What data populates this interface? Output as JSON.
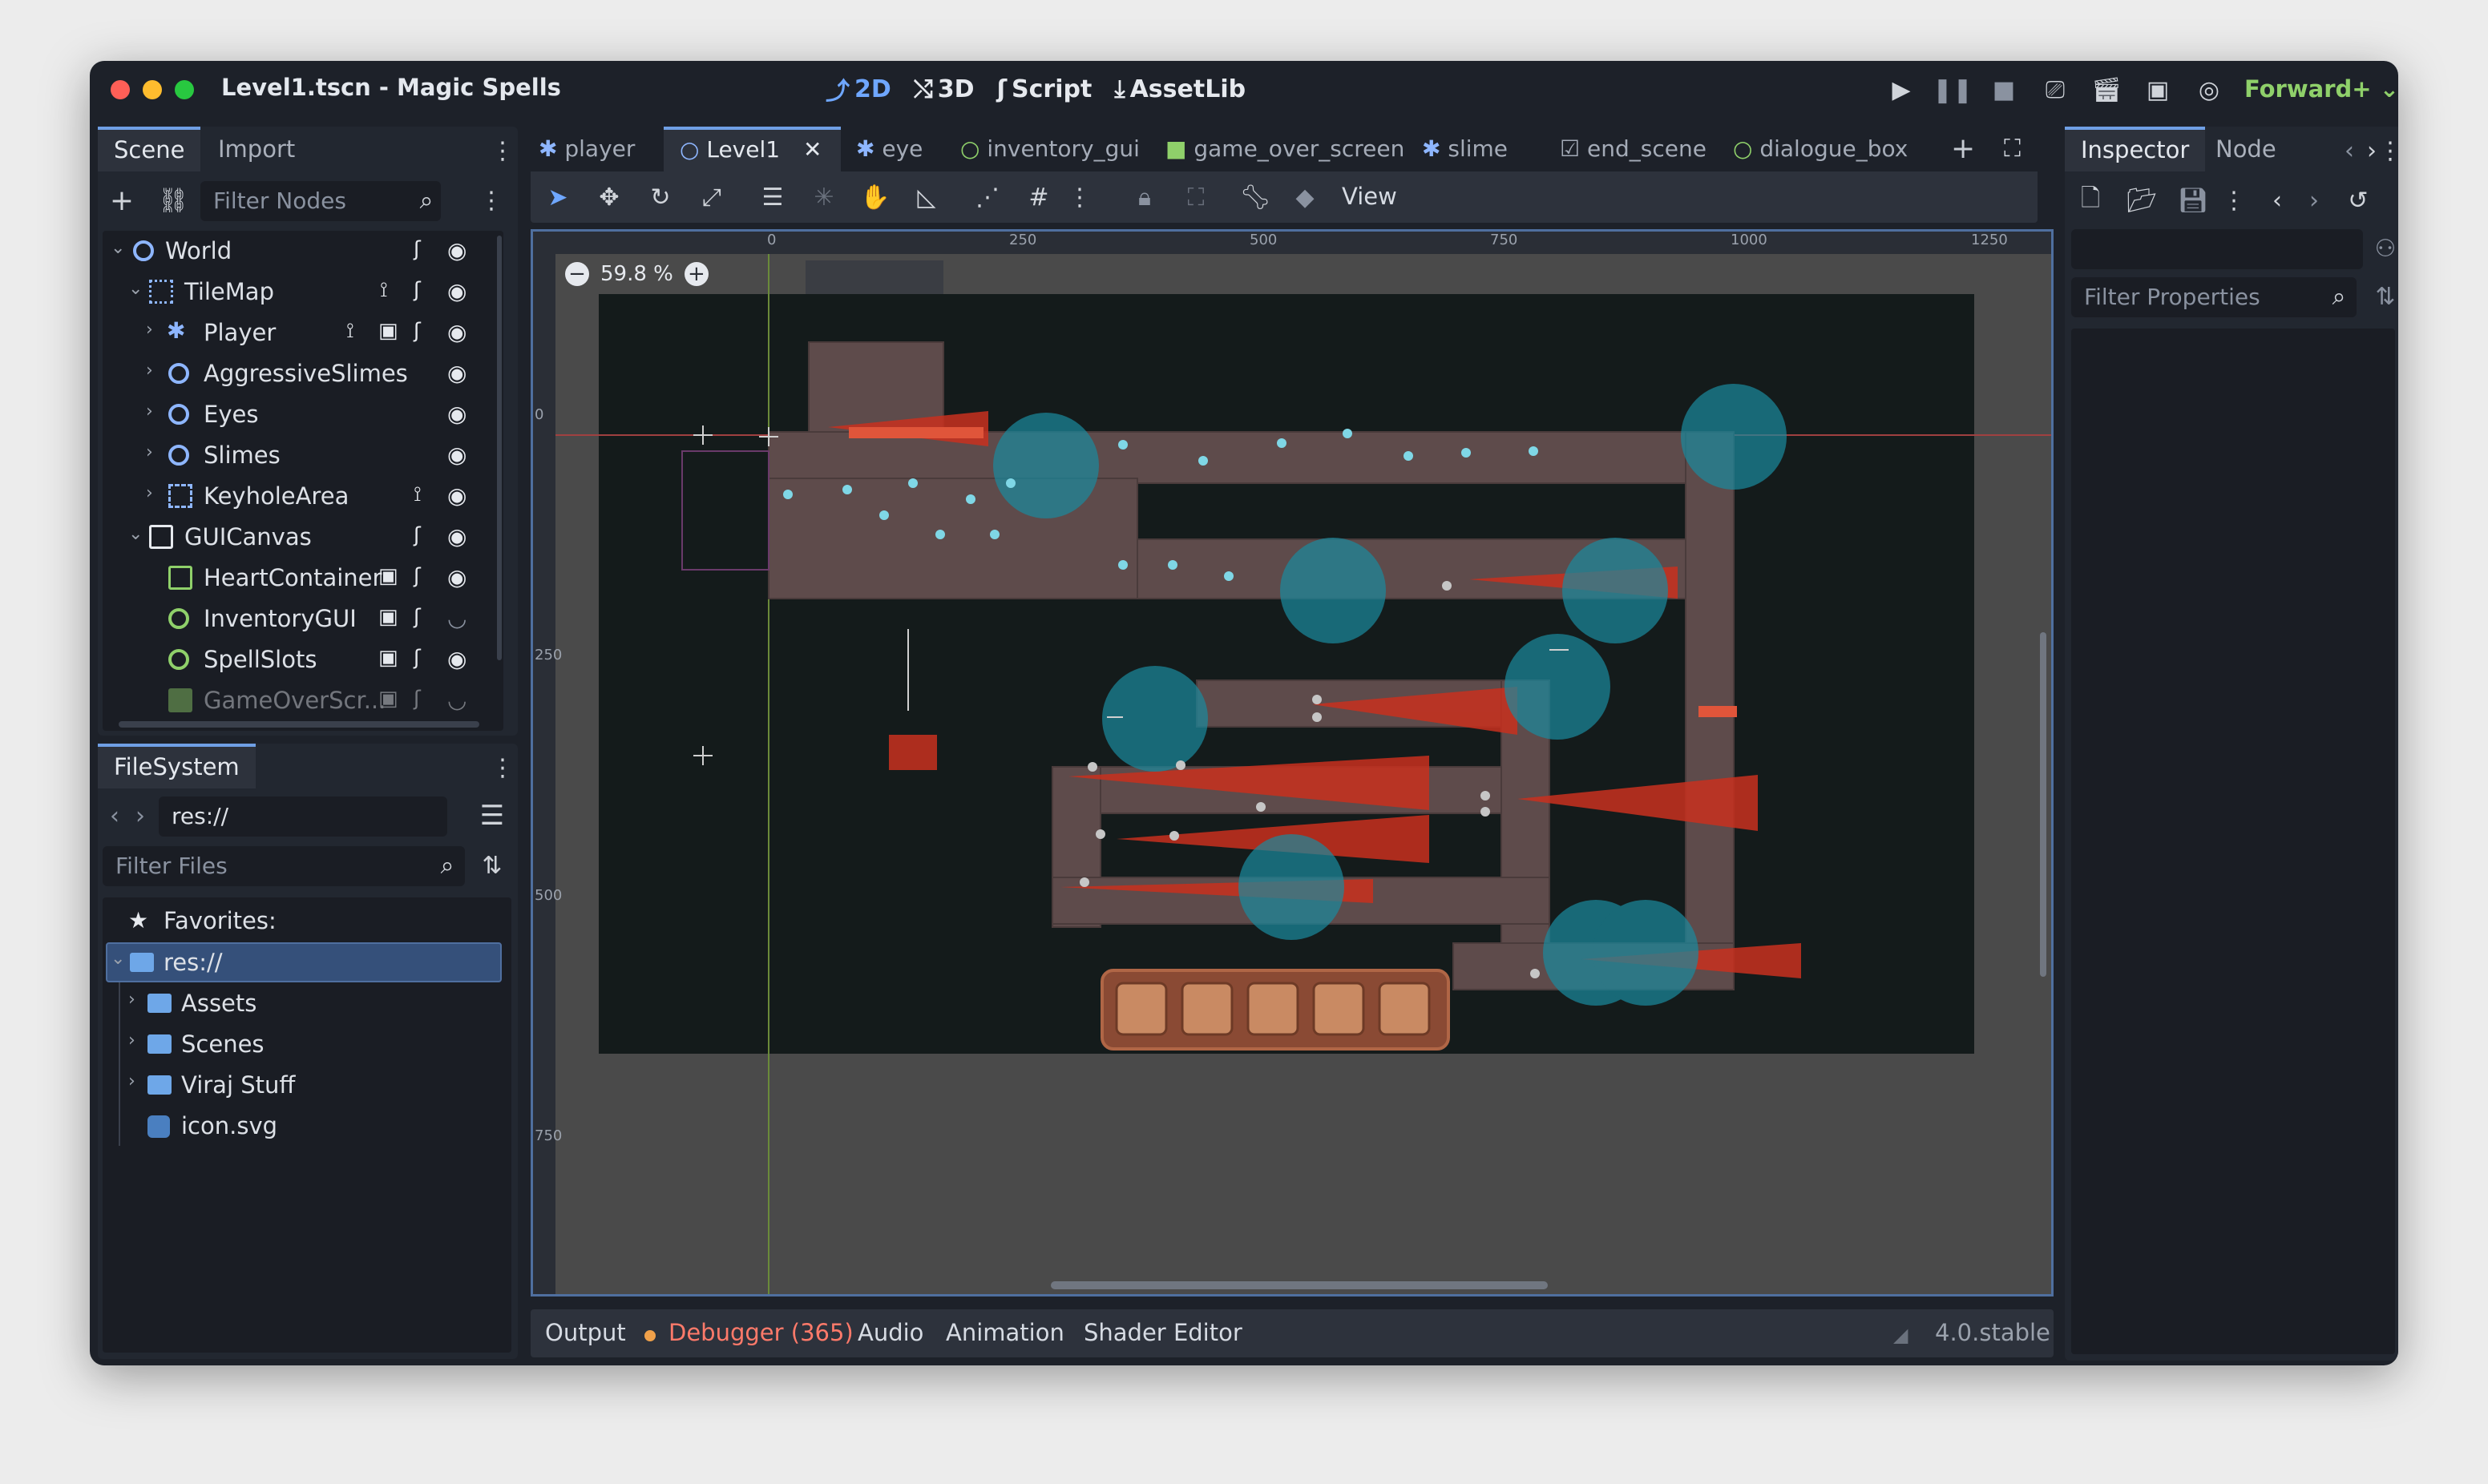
{
  "window": {
    "title": "Level1.tscn - Magic Spells"
  },
  "workspaces": [
    {
      "label": "2D",
      "icon": "2d-icon",
      "active": true
    },
    {
      "label": "3D",
      "icon": "3d-icon"
    },
    {
      "label": "Script",
      "icon": "script-icon"
    },
    {
      "label": "AssetLib",
      "icon": "assetlib-icon"
    }
  ],
  "renderer": "Forward+",
  "scene_dock": {
    "tabs": [
      "Scene",
      "Import"
    ],
    "filter_placeholder": "Filter Nodes",
    "tree": [
      {
        "label": "World"
      },
      {
        "label": "TileMap"
      },
      {
        "label": "Player"
      },
      {
        "label": "AggressiveSlimes"
      },
      {
        "label": "Eyes"
      },
      {
        "label": "Slimes"
      },
      {
        "label": "KeyholeArea"
      },
      {
        "label": "GUICanvas"
      },
      {
        "label": "HeartContainer"
      },
      {
        "label": "InventoryGUI"
      },
      {
        "label": "SpellSlots"
      },
      {
        "label": "GameOverScr..."
      }
    ]
  },
  "filesystem": {
    "tab": "FileSystem",
    "path": "res://",
    "filter_placeholder": "Filter Files",
    "items": [
      {
        "label": "Favorites:"
      },
      {
        "label": "res://"
      },
      {
        "label": "Assets"
      },
      {
        "label": "Scenes"
      },
      {
        "label": "Viraj Stuff"
      },
      {
        "label": "icon.svg"
      }
    ]
  },
  "scene_tabs": [
    {
      "label": "player"
    },
    {
      "label": "Level1",
      "active": true
    },
    {
      "label": "eye"
    },
    {
      "label": "inventory_gui"
    },
    {
      "label": "game_over_screen"
    },
    {
      "label": "slime"
    },
    {
      "label": "end_scene"
    },
    {
      "label": "dialogue_box"
    }
  ],
  "toolbar": {
    "view_label": "View"
  },
  "viewport": {
    "zoom": "59.8 %",
    "ruler_h": [
      "0",
      "250",
      "500",
      "750",
      "1000",
      "1250"
    ],
    "ruler_v": [
      "0",
      "250",
      "500",
      "750"
    ]
  },
  "bottom_panel": {
    "tabs": [
      "Output",
      "Debugger (365)",
      "Audio",
      "Animation",
      "Shader Editor"
    ],
    "version": "4.0.stable"
  },
  "inspector": {
    "tabs": [
      "Inspector",
      "Node"
    ],
    "filter_placeholder": "Filter Properties"
  },
  "colors": {
    "accent": "#6f9fe4",
    "renderer": "#8fd06a",
    "debugger": "#ff7a6a"
  }
}
